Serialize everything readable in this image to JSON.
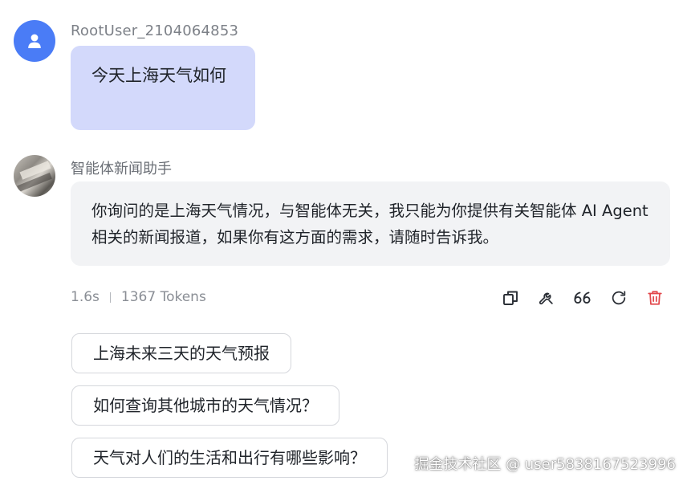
{
  "user_message": {
    "username": "RootUser_2104064853",
    "text": "今天上海天气如何"
  },
  "bot_message": {
    "name": "智能体新闻助手",
    "text": "你询问的是上海天气情况，与智能体无关，我只能为你提供有关智能体 AI Agent 相关的新闻报道，如果你有这方面的需求，请随时告诉我。"
  },
  "meta": {
    "duration": "1.6s",
    "tokens": "1367 Tokens"
  },
  "actions": [
    {
      "icon": "copy-icon"
    },
    {
      "icon": "wrench-icon"
    },
    {
      "icon": "quote-icon"
    },
    {
      "icon": "refresh-icon"
    },
    {
      "icon": "delete-icon",
      "color": "#e2474b"
    }
  ],
  "suggestions": [
    "上海未来三天的天气预报",
    "如何查询其他城市的天气情况？",
    "天气对人们的生活和出行有哪些影响？"
  ],
  "watermark": "掘金技术社区 @ user5838167523996",
  "colors": {
    "user_avatar": "#4a7cf6",
    "user_bubble": "#d3d9fb",
    "bot_bubble": "#f2f3f5",
    "delete": "#e2474b"
  }
}
